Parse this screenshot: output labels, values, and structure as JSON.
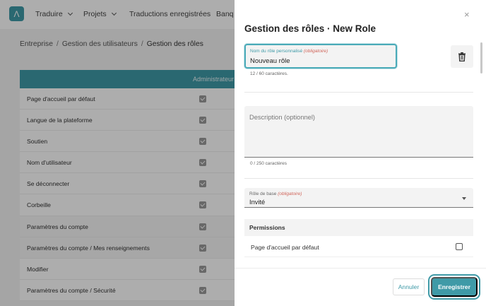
{
  "topbar": {
    "logo_glyph": "Λ",
    "nav": [
      {
        "label": "Traduire",
        "has_dropdown": true
      },
      {
        "label": "Projets",
        "has_dropdown": true
      },
      {
        "label": "Traductions enregistrées",
        "has_dropdown": false
      },
      {
        "label": "Banq",
        "has_dropdown": false
      }
    ]
  },
  "breadcrumb": {
    "items": [
      "Entreprise",
      "Gestion des utilisateurs",
      "Gestion des rôles"
    ],
    "separator": "/"
  },
  "table": {
    "column_header": "Administrateur",
    "rows": [
      {
        "label": "Page d'accueil par défaut",
        "checked": true
      },
      {
        "label": "Langue de la plateforme",
        "checked": true
      },
      {
        "label": "Soutien",
        "checked": true
      },
      {
        "label": "Nom d'utilisateur",
        "checked": true
      },
      {
        "label": "Se déconnecter",
        "checked": true
      },
      {
        "label": "Corbeille",
        "checked": true
      },
      {
        "label": "Paramètres du compte",
        "checked": true
      },
      {
        "label": "Paramètres du compte / Mes renseignements",
        "checked": true
      },
      {
        "label": "Modifier",
        "checked": true
      },
      {
        "label": "Paramètres du compte / Sécurité",
        "checked": true
      }
    ]
  },
  "drawer": {
    "title": "Gestion des rôles · New Role",
    "close_glyph": "×",
    "name_field": {
      "label": "Nom du rôle personnalisé",
      "required": "(obligatoire)",
      "value": "Nouveau rôle",
      "counter": "12 / 60 caractères."
    },
    "description_field": {
      "placeholder": "Description (optionnel)",
      "counter": "0 / 250 caractères"
    },
    "base_role_field": {
      "label": "Rôle de base",
      "required": "(obligatoire)",
      "value": "Invité"
    },
    "permissions": {
      "heading": "Permissions",
      "items": [
        {
          "label": "Page d'accueil par défaut",
          "checked": false
        }
      ]
    },
    "buttons": {
      "cancel": "Annuler",
      "save": "Enregistrer"
    }
  },
  "colors": {
    "accent": "#3f9aa7",
    "required": "#d0655a"
  }
}
